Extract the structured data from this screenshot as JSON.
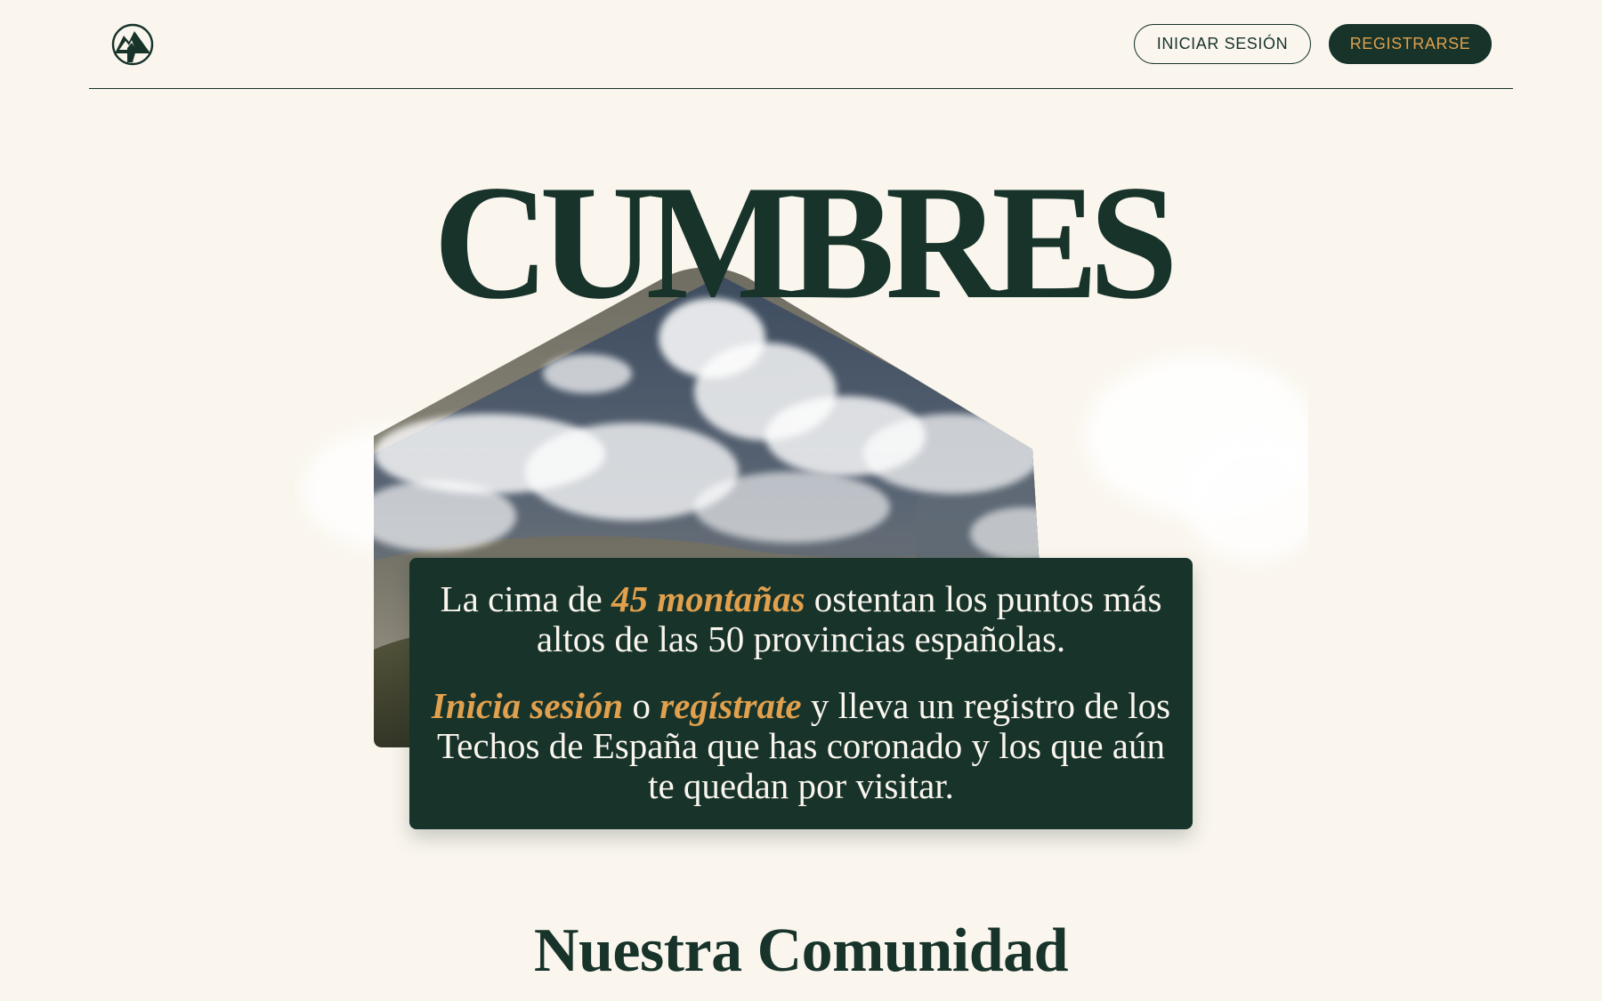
{
  "header": {
    "logo_icon": "mountain-logo-icon",
    "login_label": "INICIAR SESIÓN",
    "register_label": "REGISTRARSE"
  },
  "hero": {
    "title": "CUMBRES",
    "card": {
      "line1_pre": "La cima de ",
      "line1_accent": "45 montañas",
      "line1_post": " ostentan los puntos más altos de las 50 provincias españolas.",
      "line2_link_login": "Inicia sesión",
      "line2_mid": " o ",
      "line2_link_register": "regístrate",
      "line2_post": " y lleva un registro de los Techos de España que has coronado y los que aún te quedan por visitar."
    }
  },
  "community": {
    "title": "Nuestra Comunidad"
  },
  "colors": {
    "primary": "#17332a",
    "accent": "#e0a04d",
    "background": "#faf6ee"
  }
}
